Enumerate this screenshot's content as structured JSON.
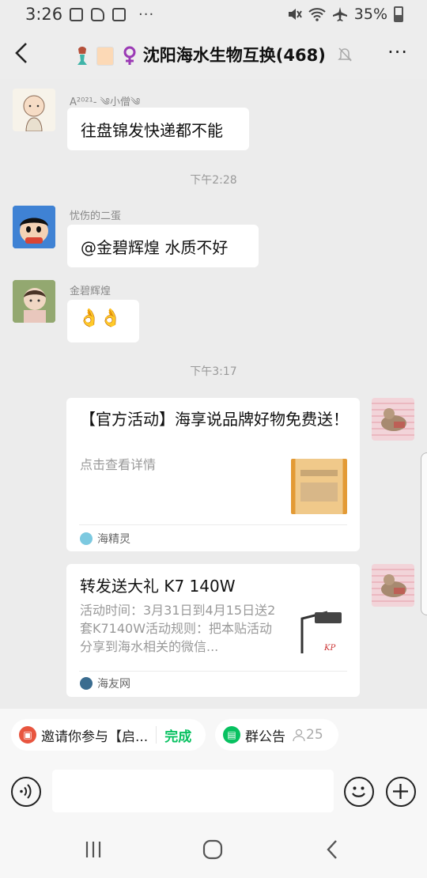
{
  "status_bar": {
    "time": "3:26",
    "more": "···",
    "battery_percent": "35%"
  },
  "header": {
    "title": "沈阳海水生物互换(468)",
    "back_icon": "chevron-left-icon",
    "more": "···",
    "mute_icon": "bell-off-icon"
  },
  "messages": [
    {
      "nickname": "A²⁰²¹‐ ༄小僧༄",
      "text": "往盘锦发快递都不能"
    },
    {
      "nickname": "忧伤的二蛋",
      "text": "@金碧辉煌  水质不好"
    },
    {
      "nickname": "金碧辉煌",
      "text": "👌👌"
    }
  ],
  "timestamps": [
    "下午2:28",
    "下午3:17"
  ],
  "cards": [
    {
      "title": "【官方活动】海享说品牌好物免费送！",
      "desc": "点击查看详情",
      "source": "海精灵"
    },
    {
      "title": "转发送大礼 K7 140W",
      "desc": "活动时间：3月31日到4月15日送2套K7140W活动规则：把本贴活动分享到海水相关的微信...",
      "source": "海友网"
    }
  ],
  "chips": {
    "invite": {
      "text": "邀请你参与【启...",
      "action": "完成"
    },
    "announcement": {
      "text": "群公告",
      "count": "25"
    }
  },
  "colors": {
    "accent_green": "#07c160",
    "bubble": "#ffffff",
    "background": "#ededed"
  }
}
